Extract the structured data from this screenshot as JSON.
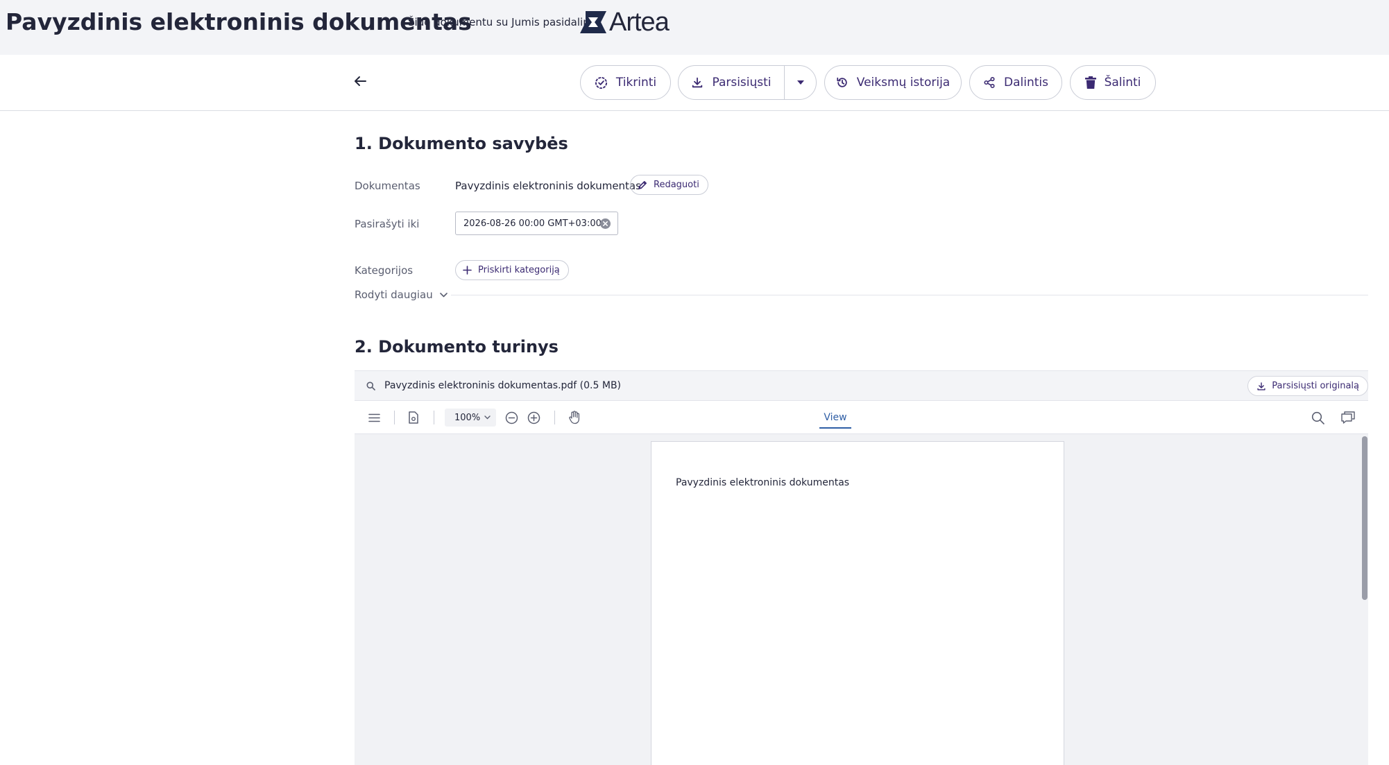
{
  "header": {
    "title": "Pavyzdinis elektroninis dokumentas",
    "shared_by": "Šiuo dokumentu su Jumis pasidalino",
    "logo_text": "Artea"
  },
  "toolbar": {
    "verify": "Tikrinti",
    "download": "Parsisiųsti",
    "history": "Veiksmų istorija",
    "share": "Dalintis",
    "delete": "Šalinti"
  },
  "section1": {
    "title": "1. Dokumento savybės",
    "document_label": "Dokumentas",
    "document_value": "Pavyzdinis elektroninis dokumentas",
    "edit_label": "Redaguoti",
    "sign_until_label": "Pasirašyti iki",
    "sign_until_value": "2026-08-26 00:00 GMT+03:00",
    "categories_label": "Kategorijos",
    "assign_category": "Priskirti kategoriją",
    "show_more": "Rodyti daugiau"
  },
  "section2": {
    "title": "2. Dokumento turinys",
    "file_name": "Pavyzdinis elektroninis dokumentas.pdf (0.5 MB)",
    "download_original": "Parsisiųsti originalą"
  },
  "viewer": {
    "zoom": "100%",
    "view_tab": "View",
    "page_text": "Pavyzdinis elektroninis dokumentas"
  },
  "colors": {
    "accent": "#3b2a72",
    "header_bg": "#f3f4f7",
    "view_tab": "#2f5ea5"
  }
}
